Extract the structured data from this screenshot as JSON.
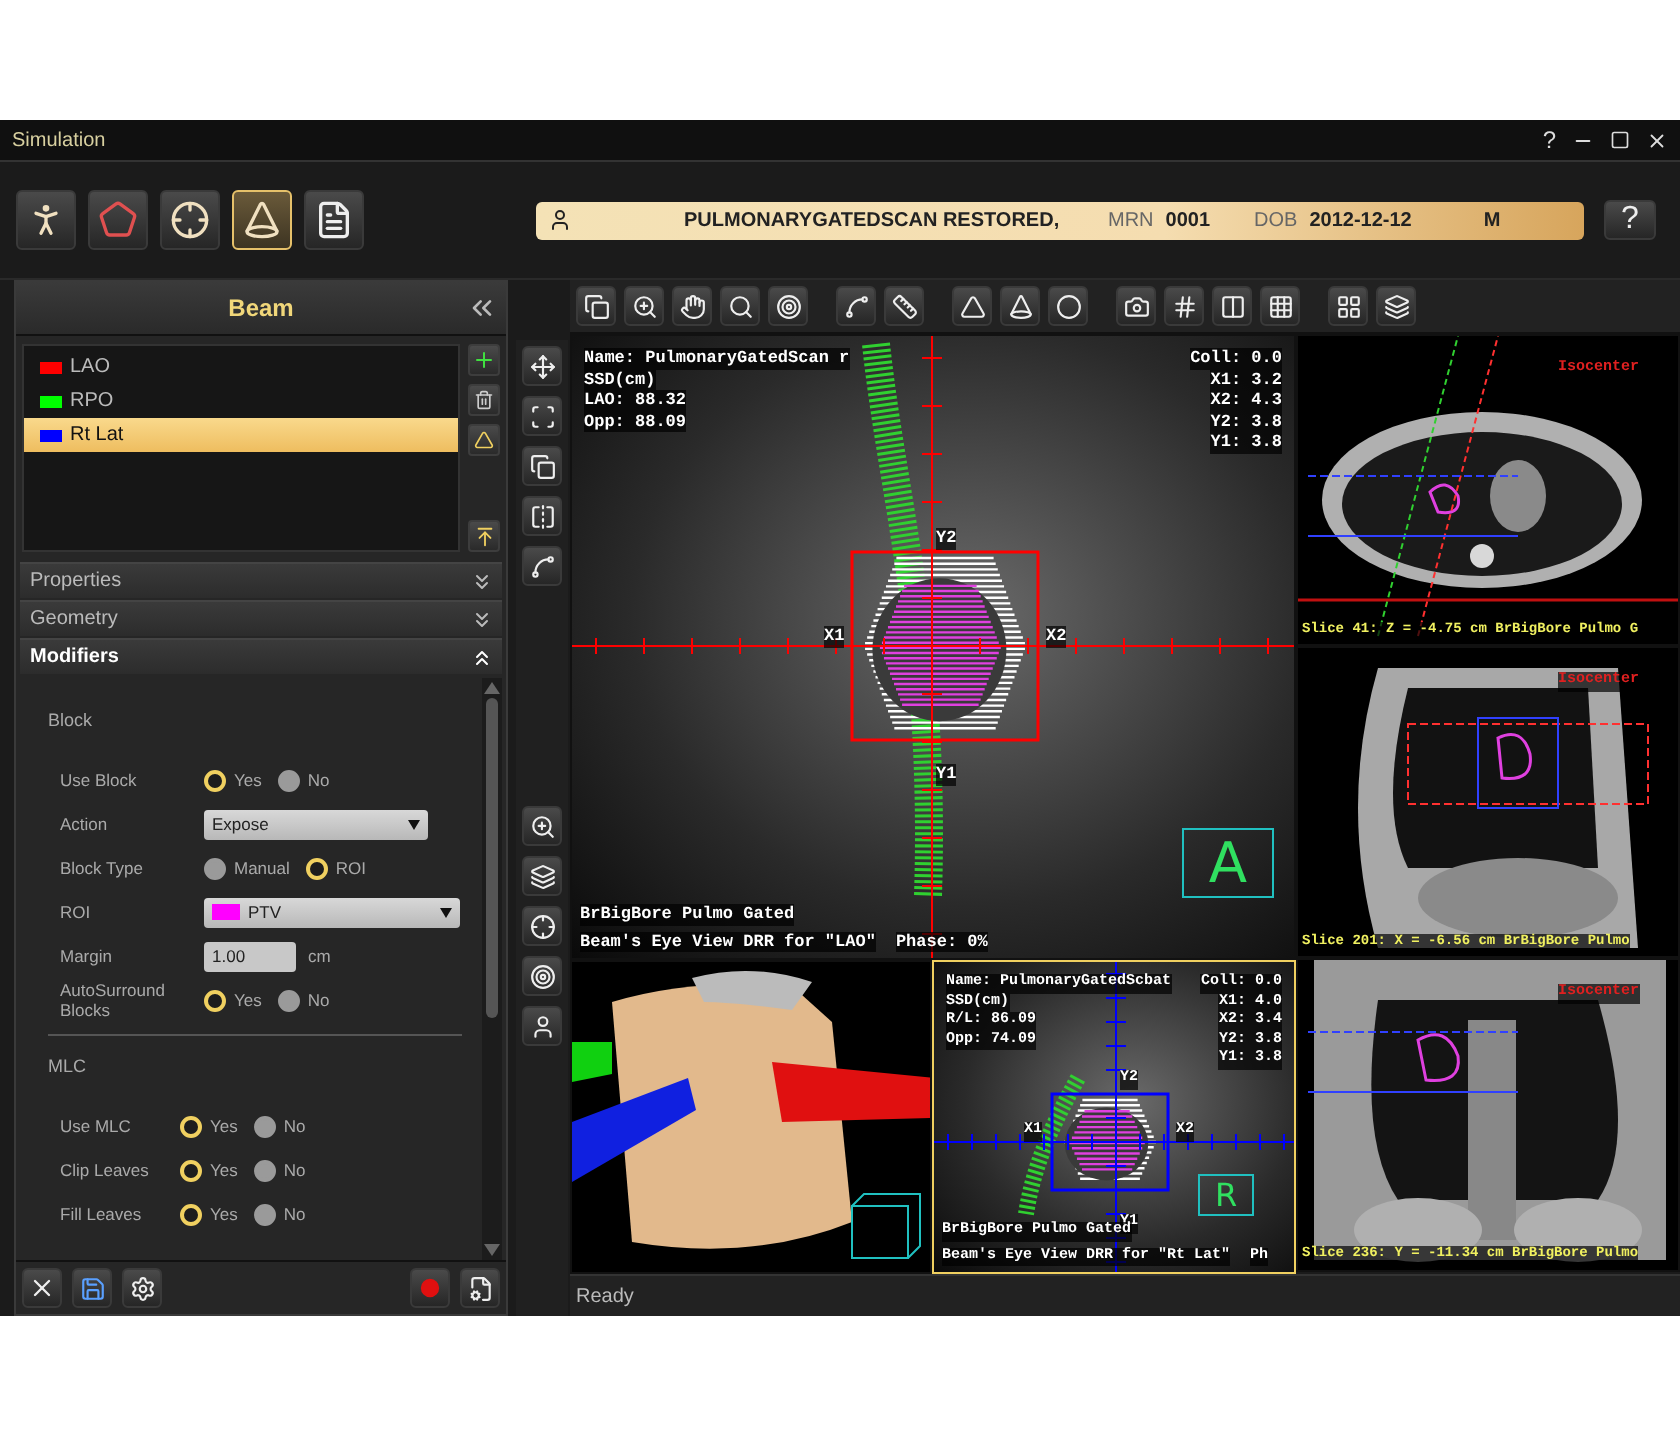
{
  "window": {
    "title": "Simulation",
    "help": "?"
  },
  "header_tools": [
    {
      "selected": false
    },
    {
      "selected": false
    },
    {
      "selected": false
    },
    {
      "selected": true
    },
    {
      "selected": false
    }
  ],
  "patient_banner": {
    "name": "PULMONARYGATEDSCAN RESTORED,",
    "mrn_label": "MRN",
    "mrn": "0001",
    "dob_label": "DOB",
    "dob": "2012-12-12",
    "sex": "M"
  },
  "help_button": "?",
  "beam_panel": {
    "title": "Beam",
    "beams": [
      {
        "name": "LAO",
        "color": "#ff0000",
        "selected": false
      },
      {
        "name": "RPO",
        "color": "#00ff00",
        "selected": false
      },
      {
        "name": "Rt Lat",
        "color": "#0000ff",
        "selected": true
      }
    ],
    "sections": [
      {
        "title": "Properties",
        "expanded": false
      },
      {
        "title": "Geometry",
        "expanded": false
      },
      {
        "title": "Modifiers",
        "expanded": true
      }
    ],
    "modifier_groups": [
      {
        "title": "Block",
        "rows": [
          {
            "kind": "radio",
            "label": "Use Block",
            "options": [
              {
                "label": "Yes",
                "selected": true
              },
              {
                "label": "No",
                "selected": false
              }
            ]
          },
          {
            "kind": "select",
            "label": "Action",
            "value": "Expose"
          },
          {
            "kind": "radio",
            "label": "Block Type",
            "options": [
              {
                "label": "Manual",
                "selected": false
              },
              {
                "label": "ROI",
                "selected": true
              }
            ]
          },
          {
            "kind": "select",
            "label": "ROI",
            "value": "PTV",
            "color": "#ff00ff"
          },
          {
            "kind": "number",
            "label": "Margin",
            "value": "1.00",
            "unit": "cm"
          },
          {
            "kind": "radio",
            "label": "AutoSurround Blocks",
            "options": [
              {
                "label": "Yes",
                "selected": true
              },
              {
                "label": "No",
                "selected": false
              }
            ]
          }
        ]
      },
      {
        "title": "MLC",
        "rows": [
          {
            "kind": "radio",
            "label": "Use MLC",
            "options": [
              {
                "label": "Yes",
                "selected": true
              },
              {
                "label": "No",
                "selected": false
              }
            ]
          },
          {
            "kind": "radio",
            "label": "Clip Leaves",
            "options": [
              {
                "label": "Yes",
                "selected": true
              },
              {
                "label": "No",
                "selected": false
              }
            ]
          },
          {
            "kind": "radio",
            "label": "Fill Leaves",
            "options": [
              {
                "label": "Yes",
                "selected": true
              },
              {
                "label": "No",
                "selected": false
              }
            ]
          }
        ]
      }
    ]
  },
  "beam_views": [
    {
      "color": "#ff0000",
      "selected": false,
      "info_left": [
        "Name: PulmonaryGatedScan r",
        "SSD(cm)",
        "LAO: 88.32",
        "Opp: 88.09"
      ],
      "info_right": [
        "Coll: 0.0",
        "X1: 3.2",
        "X2: 4.3",
        "Y2: 3.8",
        "Y1: 3.8"
      ],
      "jaw_labels": [
        "Y2",
        "X1",
        "X2",
        "Y1"
      ],
      "orientation": "A",
      "captions": [
        "BrBigBore Pulmo Gated",
        "Beam's Eye View DRR for \"LAO\""
      ],
      "phase": "Phase: 0%"
    },
    {
      "color": "#0000ff",
      "selected": true,
      "info_left": [
        "Name: PulmonaryGatedScbat",
        "SSD(cm)",
        "R/L: 86.09",
        "Opp: 74.09"
      ],
      "info_right": [
        "Coll: 0.0",
        "X1: 4.0",
        "X2: 3.4",
        "Y2: 3.8",
        "Y1: 3.8"
      ],
      "jaw_labels": [
        "Y2",
        "X1",
        "X2",
        "Y1"
      ],
      "orientation": "R",
      "captions": [
        "BrBigBore Pulmo Gated",
        "Beam's Eye View DRR for \"Rt Lat\""
      ],
      "phase": "Ph"
    }
  ],
  "slices": [
    {
      "kind": "axial",
      "label": "Isocenter",
      "caption": "Slice 41: Z = -4.75 cm BrBigBore Pulmo G"
    },
    {
      "kind": "sagittal",
      "label": "Isocenter",
      "caption": "Slice 201: X = -6.56 cm BrBigBore Pulmo"
    },
    {
      "kind": "coronal",
      "label": "Isocenter",
      "caption": "Slice 236: Y = -11.34 cm BrBigBore Pulmo"
    }
  ],
  "status_bar": "Ready"
}
